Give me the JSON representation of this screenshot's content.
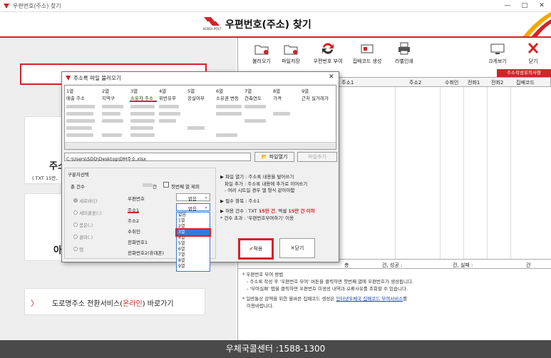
{
  "window": {
    "title": "우편번호(주소) 찾기",
    "app_title": "우편번호(주소) 찾기",
    "logo_text": "KOREA POST"
  },
  "left": {
    "card_addr_text": "주소",
    "card_addr_sub": "( TXT 15만, ",
    "card_apply_text": "아",
    "road_link": "도로명주소 전환서비스(",
    "road_link_online": "온라인",
    "road_link_end": ") 바로가기"
  },
  "toolbar": {
    "items": [
      "불러오기",
      "파일저장",
      "우편번호 부여",
      "집배코드 생성",
      "라벨인쇄",
      "크게보기",
      "닫기"
    ]
  },
  "grid": {
    "warning_tag": "주소작성유의사항",
    "columns": [
      "주소1",
      "주소2",
      "수취인",
      "전화1",
      "전화2",
      "집배코드"
    ],
    "stats": {
      "a": "총",
      "b": "건, 성공 :",
      "c": "건, 실패 :",
      "d": "건"
    }
  },
  "notes": {
    "h1": "* 우편번호 부여 방법",
    "l1": "- 주소록 작성 후 '우편번호 부여' 버튼을 클릭하면 첫번째 열에 우편번호가 생성됩니다.",
    "l2": "- '부여실패' 탭을 클릭하면 우편번호 미생성 내역과 오류사유를 조회할 수 있습니다.",
    "h2_a": "* 일반통상 감액을 위한 올바른 집배코드 생성은 ",
    "h2_link": "인터넷우체국 집배코드 부여서비스",
    "h2_b": "를",
    "h2_c": "이용바랍니다."
  },
  "dialog": {
    "title": "주소록 파일 불러오기",
    "col_nums": [
      "1열",
      "2열",
      "3열",
      "4열",
      "5열",
      "6열",
      "7열",
      "8열",
      "9열"
    ],
    "col_names": [
      "매출 주소",
      "지역구",
      "소유자 주소",
      "위반유무",
      "공실여부",
      "소유권 변동",
      "건축연도",
      "가격",
      "근처 실거래가"
    ],
    "path": "C:\\Users\\SDD\\Desktop\\DM주소.xlsx",
    "btn_open": "파일열기",
    "btn_append": "파일추가",
    "section_label": "구분자선택",
    "total_label": "총 건수",
    "total_unit": "건",
    "chk_first_row": "첫번째 열 제외",
    "radios": [
      "세로바(|)",
      "세미콜론(;)",
      "콤문(,)",
      "콜마(.)",
      "탭"
    ],
    "fields": [
      "우편번호",
      "주소1",
      "주소2",
      "수취인",
      "전화번호1",
      "전화번호2(휴대폰)"
    ],
    "sel_zip": "없음",
    "sel_addr1": "없음",
    "dropdown_options": [
      "없음",
      "1열",
      "2열",
      "3열",
      "4열",
      "5열",
      "6열",
      "7열",
      "8열",
      "9열"
    ],
    "info1": "▶ 파일 열기 : 주소록 내용을 덮어쓰기",
    "info2": "파일 추가 : 주소록 내용에 추가로 이어쓰기",
    "info3": "- 여러 시트일 경우 엘 형식 같아야함",
    "info4": "▶ 필수 항목 : 주소1",
    "info5a": "▶ 허용 건수 : TXT ",
    "info5b": "15만 건",
    "info5c": ", 엑셀 ",
    "info5d": "15만 건 이하",
    "info6": "* 건수 초과 : '우편번호부여하기' 이용",
    "btn_ok": "적용",
    "btn_close": "닫기"
  },
  "footer": {
    "text": "우체국콜센터 :1588-1300"
  }
}
